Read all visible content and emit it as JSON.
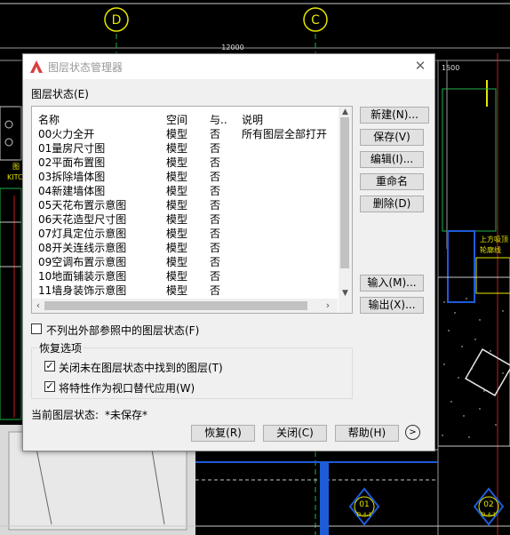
{
  "background": {
    "grid_markers": [
      "D",
      "C"
    ],
    "dimension_top": "12000",
    "dimension_right": "1500",
    "left_tags": [
      "图",
      "KITC"
    ],
    "right_annotation": [
      "上方吸顶",
      "轮廓线"
    ],
    "bottom_markers": [
      {
        "num": "01",
        "code": "D-4-1"
      },
      {
        "num": "02",
        "code": "D-4-1"
      }
    ]
  },
  "dialog": {
    "title": "图层状态管理器",
    "layer_states_label": "图层状态(E)",
    "columns": [
      "名称",
      "空间",
      "与..",
      "说明"
    ],
    "rows": [
      {
        "name": "00火力全开",
        "space": "模型",
        "same": "否",
        "desc": "所有图层全部打开"
      },
      {
        "name": "01量房尺寸图",
        "space": "模型",
        "same": "否",
        "desc": ""
      },
      {
        "name": "02平面布置图",
        "space": "模型",
        "same": "否",
        "desc": ""
      },
      {
        "name": "03拆除墙体图",
        "space": "模型",
        "same": "否",
        "desc": ""
      },
      {
        "name": "04新建墙体图",
        "space": "模型",
        "same": "否",
        "desc": ""
      },
      {
        "name": "05天花布置示意图",
        "space": "模型",
        "same": "否",
        "desc": ""
      },
      {
        "name": "06天花造型尺寸图",
        "space": "模型",
        "same": "否",
        "desc": ""
      },
      {
        "name": "07灯具定位示意图",
        "space": "模型",
        "same": "否",
        "desc": ""
      },
      {
        "name": "08开关连线示意图",
        "space": "模型",
        "same": "否",
        "desc": ""
      },
      {
        "name": "09空调布置示意图",
        "space": "模型",
        "same": "否",
        "desc": ""
      },
      {
        "name": "10地面铺装示意图",
        "space": "模型",
        "same": "否",
        "desc": ""
      },
      {
        "name": "11墙身装饰示意图",
        "space": "模型",
        "same": "否",
        "desc": ""
      }
    ],
    "side_buttons": {
      "new": "新建(N)...",
      "save": "保存(V)",
      "edit": "编辑(I)...",
      "rename": "重命名",
      "delete": "删除(D)",
      "import": "输入(M)...",
      "export": "输出(X)..."
    },
    "exclude_xref": {
      "label": "不列出外部参照中的图层状态(F)",
      "checked": false
    },
    "restore_options": {
      "title": "恢复选项",
      "turn_off": {
        "label": "关闭未在图层状态中找到的图层(T)",
        "checked": true
      },
      "viewport_override": {
        "label": "将特性作为视口替代应用(W)",
        "checked": true
      }
    },
    "current_state_label": "当前图层状态:",
    "current_state_value": "*未保存*",
    "footer_buttons": {
      "restore": "恢复(R)",
      "close": "关闭(C)",
      "help": "帮助(H)"
    },
    "more_icon": "chevron-right-icon",
    "checkmark": "✓"
  },
  "colors": {
    "cad_bg": "#000000",
    "grid_yellow": "#e6e600",
    "cad_blue": "#1e5bd6",
    "cad_red": "#c81e1e",
    "cad_green": "#22b14c",
    "dialog_bg": "#f0f0f0",
    "app_icon_red": "#d83b3b"
  }
}
